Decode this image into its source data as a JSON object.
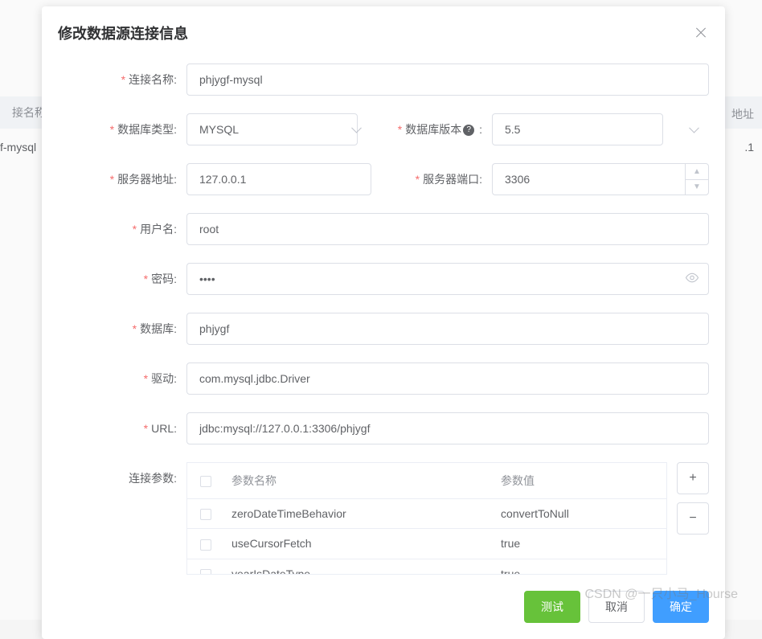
{
  "background": {
    "header_name": "接名称",
    "header_addr": "地址",
    "row_name": "f-mysql",
    "row_addr": ".1"
  },
  "dialog": {
    "title": "修改数据源连接信息"
  },
  "labels": {
    "conn_name": "连接名称:",
    "db_type": "数据库类型:",
    "db_version": "数据库版本",
    "version_suffix": " :",
    "server_addr": "服务器地址:",
    "server_port": "服务器端口:",
    "username": "用户名:",
    "password": "密码:",
    "database": "数据库:",
    "driver": "驱动:",
    "url": "URL:",
    "conn_params": "连接参数:"
  },
  "values": {
    "conn_name": "phjygf-mysql",
    "db_type": "MYSQL",
    "db_version": "5.5",
    "server_addr": "127.0.0.1",
    "server_port": "3306",
    "username": "root",
    "password": "••••",
    "database": "phjygf",
    "driver": "com.mysql.jdbc.Driver",
    "url": "jdbc:mysql://127.0.0.1:3306/phjygf"
  },
  "params_table": {
    "col_name": "参数名称",
    "col_value": "参数值",
    "rows": [
      {
        "name": "zeroDateTimeBehavior",
        "value": "convertToNull"
      },
      {
        "name": "useCursorFetch",
        "value": "true"
      },
      {
        "name": "yearIsDateType",
        "value": "true"
      }
    ]
  },
  "buttons": {
    "test": "测试",
    "cancel": "取消",
    "confirm": "确定",
    "add": "+",
    "remove": "−"
  },
  "watermark": "CSDN @一只小马_Hourse"
}
